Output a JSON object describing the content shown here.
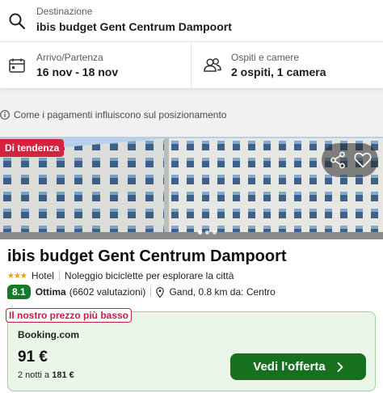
{
  "search": {
    "destination_label": "Destinazione",
    "destination_value": "ibis budget Gent Centrum Dampoort",
    "dates_label": "Arrivo/Partenza",
    "dates_value": "16 nov - 18 nov",
    "guests_label": "Ospiti e camere",
    "guests_value": "2 ospiti, 1 camera"
  },
  "info_text": "Come i pagamenti influiscono sul posizionamento",
  "hotel": {
    "trending_badge": "Di tendenza",
    "name": "ibis budget Gent Centrum Dampoort",
    "stars": "★★★",
    "type": "Hotel",
    "feature": "Noleggio biciclette per esplorare la città",
    "score": "8.1",
    "score_word": "Ottima",
    "reviews": "(6602 valutazioni)",
    "location": "Gand, 0.8 km da: Centro"
  },
  "deal": {
    "tag": "Il nostro prezzo più basso",
    "provider": "Booking.com",
    "price": "91 €",
    "nights_prefix": "2 notti a",
    "total": "181 €",
    "button_label": "Vedi l'offerta"
  },
  "icons": {
    "search": "search-icon",
    "calendar": "calendar-icon",
    "guests": "guests-icon",
    "info": "info-icon",
    "share": "share-icon",
    "heart": "heart-icon",
    "pin": "map-pin-icon",
    "chevron": "chevron-right-icon"
  },
  "colors": {
    "badge_red": "#d3243f",
    "score_green": "#157a2a",
    "button_green": "#16701f",
    "deal_bg": "#eaf7e8",
    "stars": "#e8a000"
  }
}
